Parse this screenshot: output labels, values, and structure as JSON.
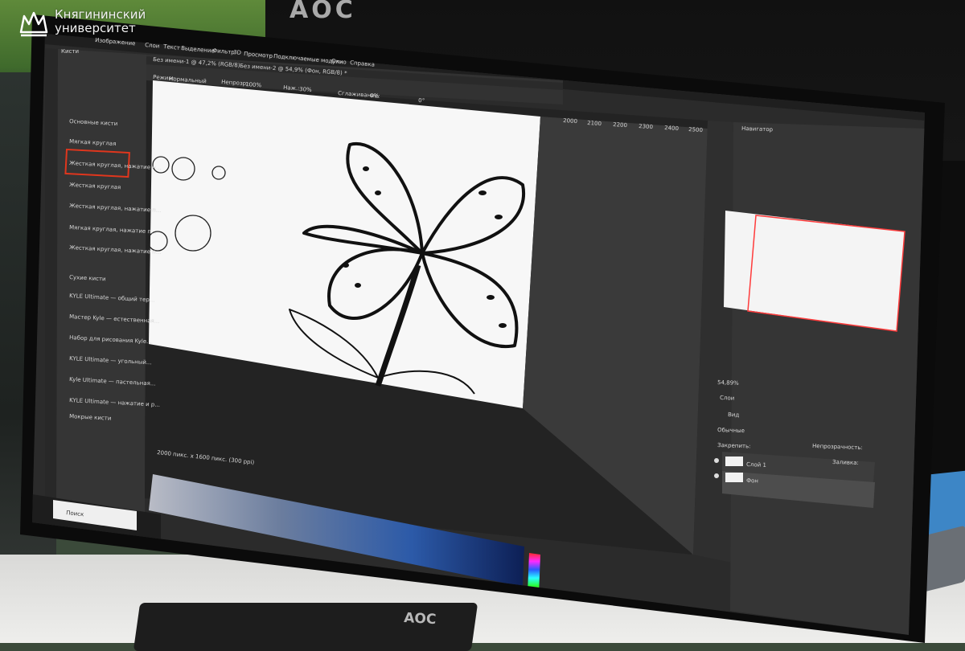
{
  "watermark": {
    "line1": "Княгининский",
    "line2": "университет"
  },
  "app": {
    "menu": [
      "Изображение",
      "Слои",
      "Текст",
      "Выделение",
      "Фильтр",
      "3D",
      "Просмотр",
      "Подключаемые модули",
      "Окно",
      "Справка"
    ],
    "tabs": [
      {
        "label": "Без имени-1 @ 47,2% (RGB/8)"
      },
      {
        "label": "Без имени-2 @ 54,9% (Фон, RGB/8) *"
      }
    ],
    "options": {
      "mode_label": "Режим:",
      "mode_value": "Нормальный",
      "opacity_label": "Непрозр.:",
      "opacity_value": "100%",
      "flow_label": "Наж.:",
      "flow_value": "30%",
      "smoothing_label": "Сглаживание:",
      "smoothing_value": "0%",
      "angle_value": "0°"
    },
    "ruler_marks": [
      "2000",
      "2100",
      "2200",
      "2300",
      "2400",
      "2500"
    ],
    "brushes_panel": {
      "title": "Кисти",
      "group_main": "Основные кисти",
      "items": [
        {
          "label": "Мягкая круглая",
          "selected": false
        },
        {
          "label": "Жесткая круглая, нажатие н...",
          "selected": true
        },
        {
          "label": "Жесткая круглая",
          "selected": false
        },
        {
          "label": "Жесткая круглая, нажатие п...",
          "selected": false
        },
        {
          "label": "Мягкая круглая, нажатие п...",
          "selected": false
        },
        {
          "label": "Жесткая круглая, нажатие п...",
          "selected": false
        }
      ],
      "group_dry": "Сухие кисти",
      "dry_items": [
        {
          "label": "KYLE Ultimate — общий тер..."
        },
        {
          "label": "Мастер Kyle — естественная..."
        },
        {
          "label": "Набор для рисования Kyle..."
        },
        {
          "label": "KYLE Ultimate — угольный..."
        },
        {
          "label": "Kyle Ultimate — пастельная..."
        },
        {
          "label": "KYLE Ultimate — нажатие и р..."
        }
      ],
      "group_wet": "Мокрые кисти"
    },
    "navigator": {
      "title": "Навигатор",
      "zoom": "54,89%"
    },
    "layers": {
      "title": "Слои",
      "kind_label": "Вид",
      "blend_value": "Обычные",
      "opacity_label": "Непрозрачность:",
      "lock_label": "Закрепить:",
      "fill_label": "Заливка:",
      "items": [
        {
          "name": "Слой 1",
          "visible": true
        },
        {
          "name": "Фон",
          "visible": true,
          "locked": true
        }
      ]
    },
    "status_bar": "2000 пикс. x 1600 пикс. (300 ppi)",
    "taskbar": {
      "search_placeholder": "Поиск"
    }
  },
  "monitor_brand": "AOC",
  "monitor2_brand": "AOC",
  "colors": {
    "ps_dark": "#232323",
    "ps_panel": "#3a3a3a",
    "ps_accent": "#2d7bd6",
    "brush_select_border": "#e0361d",
    "nav_box": "#ff3b3b"
  }
}
